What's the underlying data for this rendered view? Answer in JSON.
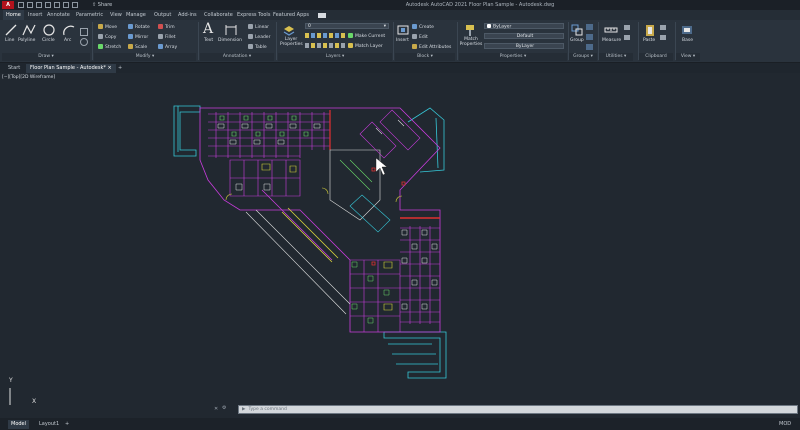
{
  "titlebar": {
    "logo": "A CAD",
    "share_label": "Share",
    "title": "Autodesk AutoCAD 2021   Floor Plan Sample - Autodesk.dwg"
  },
  "ribbon_tabs": [
    "Home",
    "Insert",
    "Annotate",
    "Parametric",
    "View",
    "Manage",
    "Output",
    "Add-ins",
    "Collaborate",
    "Express Tools",
    "Featured Apps"
  ],
  "draw": {
    "line": "Line",
    "polyline": "Polyline",
    "circle": "Circle",
    "arc": "Arc",
    "title": "Draw ▾"
  },
  "modify": {
    "move": "Move",
    "rotate": "Rotate",
    "trim": "Trim",
    "copy": "Copy",
    "mirror": "Mirror",
    "fillet": "Fillet",
    "stretch": "Stretch",
    "scale": "Scale",
    "array": "Array",
    "title": "Modify ▾"
  },
  "annotation": {
    "text": "Text",
    "dimension": "Dimension",
    "linear": "Linear",
    "leader": "Leader",
    "table": "Table",
    "title": "Annotation ▾"
  },
  "layers": {
    "layer_properties": "Layer Properties",
    "current": "0",
    "make_current": "Make Current",
    "match_layer": "Match Layer",
    "title": "Layers ▾"
  },
  "block": {
    "insert": "Insert",
    "create": "Create",
    "edit": "Edit",
    "edit_attributes": "Edit Attributes",
    "title": "Block ▾"
  },
  "properties": {
    "match": "Match Properties",
    "color": "ByLayer",
    "lineweight": "Default",
    "linetype": "ByLayer",
    "title": "Properties ▾"
  },
  "groups": {
    "group": "Group",
    "title": "Groups ▾"
  },
  "utilities": {
    "measure": "Measure",
    "title": "Utilities ▾"
  },
  "clipboard": {
    "paste": "Paste",
    "title": "Clipboard"
  },
  "view_panel": {
    "base": "Base",
    "title": "View ▾"
  },
  "file_tabs": {
    "start": "Start",
    "active": "Floor Plan Sample - Autodesk*",
    "add": "+"
  },
  "viewport_label": "[−][Top][2D Wireframe]",
  "command": {
    "placeholder": "Type a command"
  },
  "status": {
    "model": "Model",
    "layout1": "Layout1",
    "add": "+",
    "right": "MOD"
  },
  "ucs": {
    "x": "X",
    "y": "Y"
  },
  "colors": {
    "cyan": "#36c8d8",
    "magenta": "#c83cdc",
    "yellow": "#d8d43a",
    "red": "#e03030",
    "white": "#e0e0e0",
    "green": "#6ad86a"
  }
}
